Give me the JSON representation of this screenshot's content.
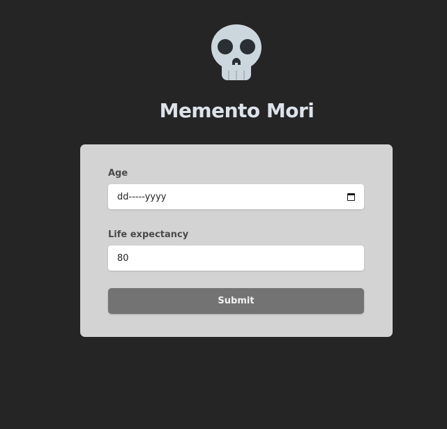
{
  "app": {
    "title": "Memento Mori",
    "logo_icon": "skull-icon"
  },
  "form": {
    "age_label": "Age",
    "age_placeholder": "dd-----yyyy",
    "life_label": "Life expectancy",
    "life_value": "80",
    "submit_label": "Submit"
  },
  "colors": {
    "background": "#252525",
    "card": "#d3d3d3",
    "button": "#737373",
    "title": "#dde3ea",
    "skull": "#ccd6dd"
  }
}
